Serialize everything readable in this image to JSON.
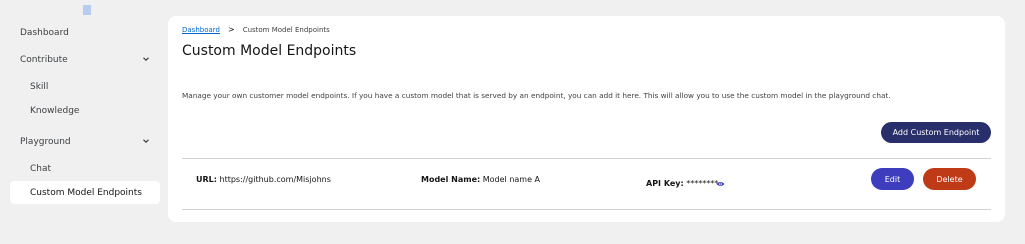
{
  "sidebar": {
    "items": [
      {
        "label": "Dashboard"
      },
      {
        "label": "Contribute"
      },
      {
        "label": "Skill"
      },
      {
        "label": "Knowledge"
      },
      {
        "label": "Playground"
      },
      {
        "label": "Chat"
      },
      {
        "label": "Custom Model Endpoints"
      }
    ]
  },
  "breadcrumb": {
    "parent": "Dashboard",
    "separator": ">",
    "current": "Custom Model Endpoints"
  },
  "page": {
    "title": "Custom Model Endpoints",
    "description": "Manage your own customer model endpoints. If you have a custom model that is served by an endpoint, you can add it here. This will allow you to use the custom model in the playground chat.",
    "add_button": "Add Custom Endpoint"
  },
  "endpoint": {
    "url_label": "URL:",
    "url_value": "https://github.com/Misjohns",
    "model_label": "Model Name:",
    "model_value": "Model name A",
    "key_label": "API Key:",
    "key_value": "********",
    "edit_label": "Edit",
    "delete_label": "Delete"
  },
  "colors": {
    "primary_button": "#292f6b",
    "edit_button": "#3d3dbd",
    "delete_button": "#bf3a17",
    "link": "#0066cc"
  }
}
